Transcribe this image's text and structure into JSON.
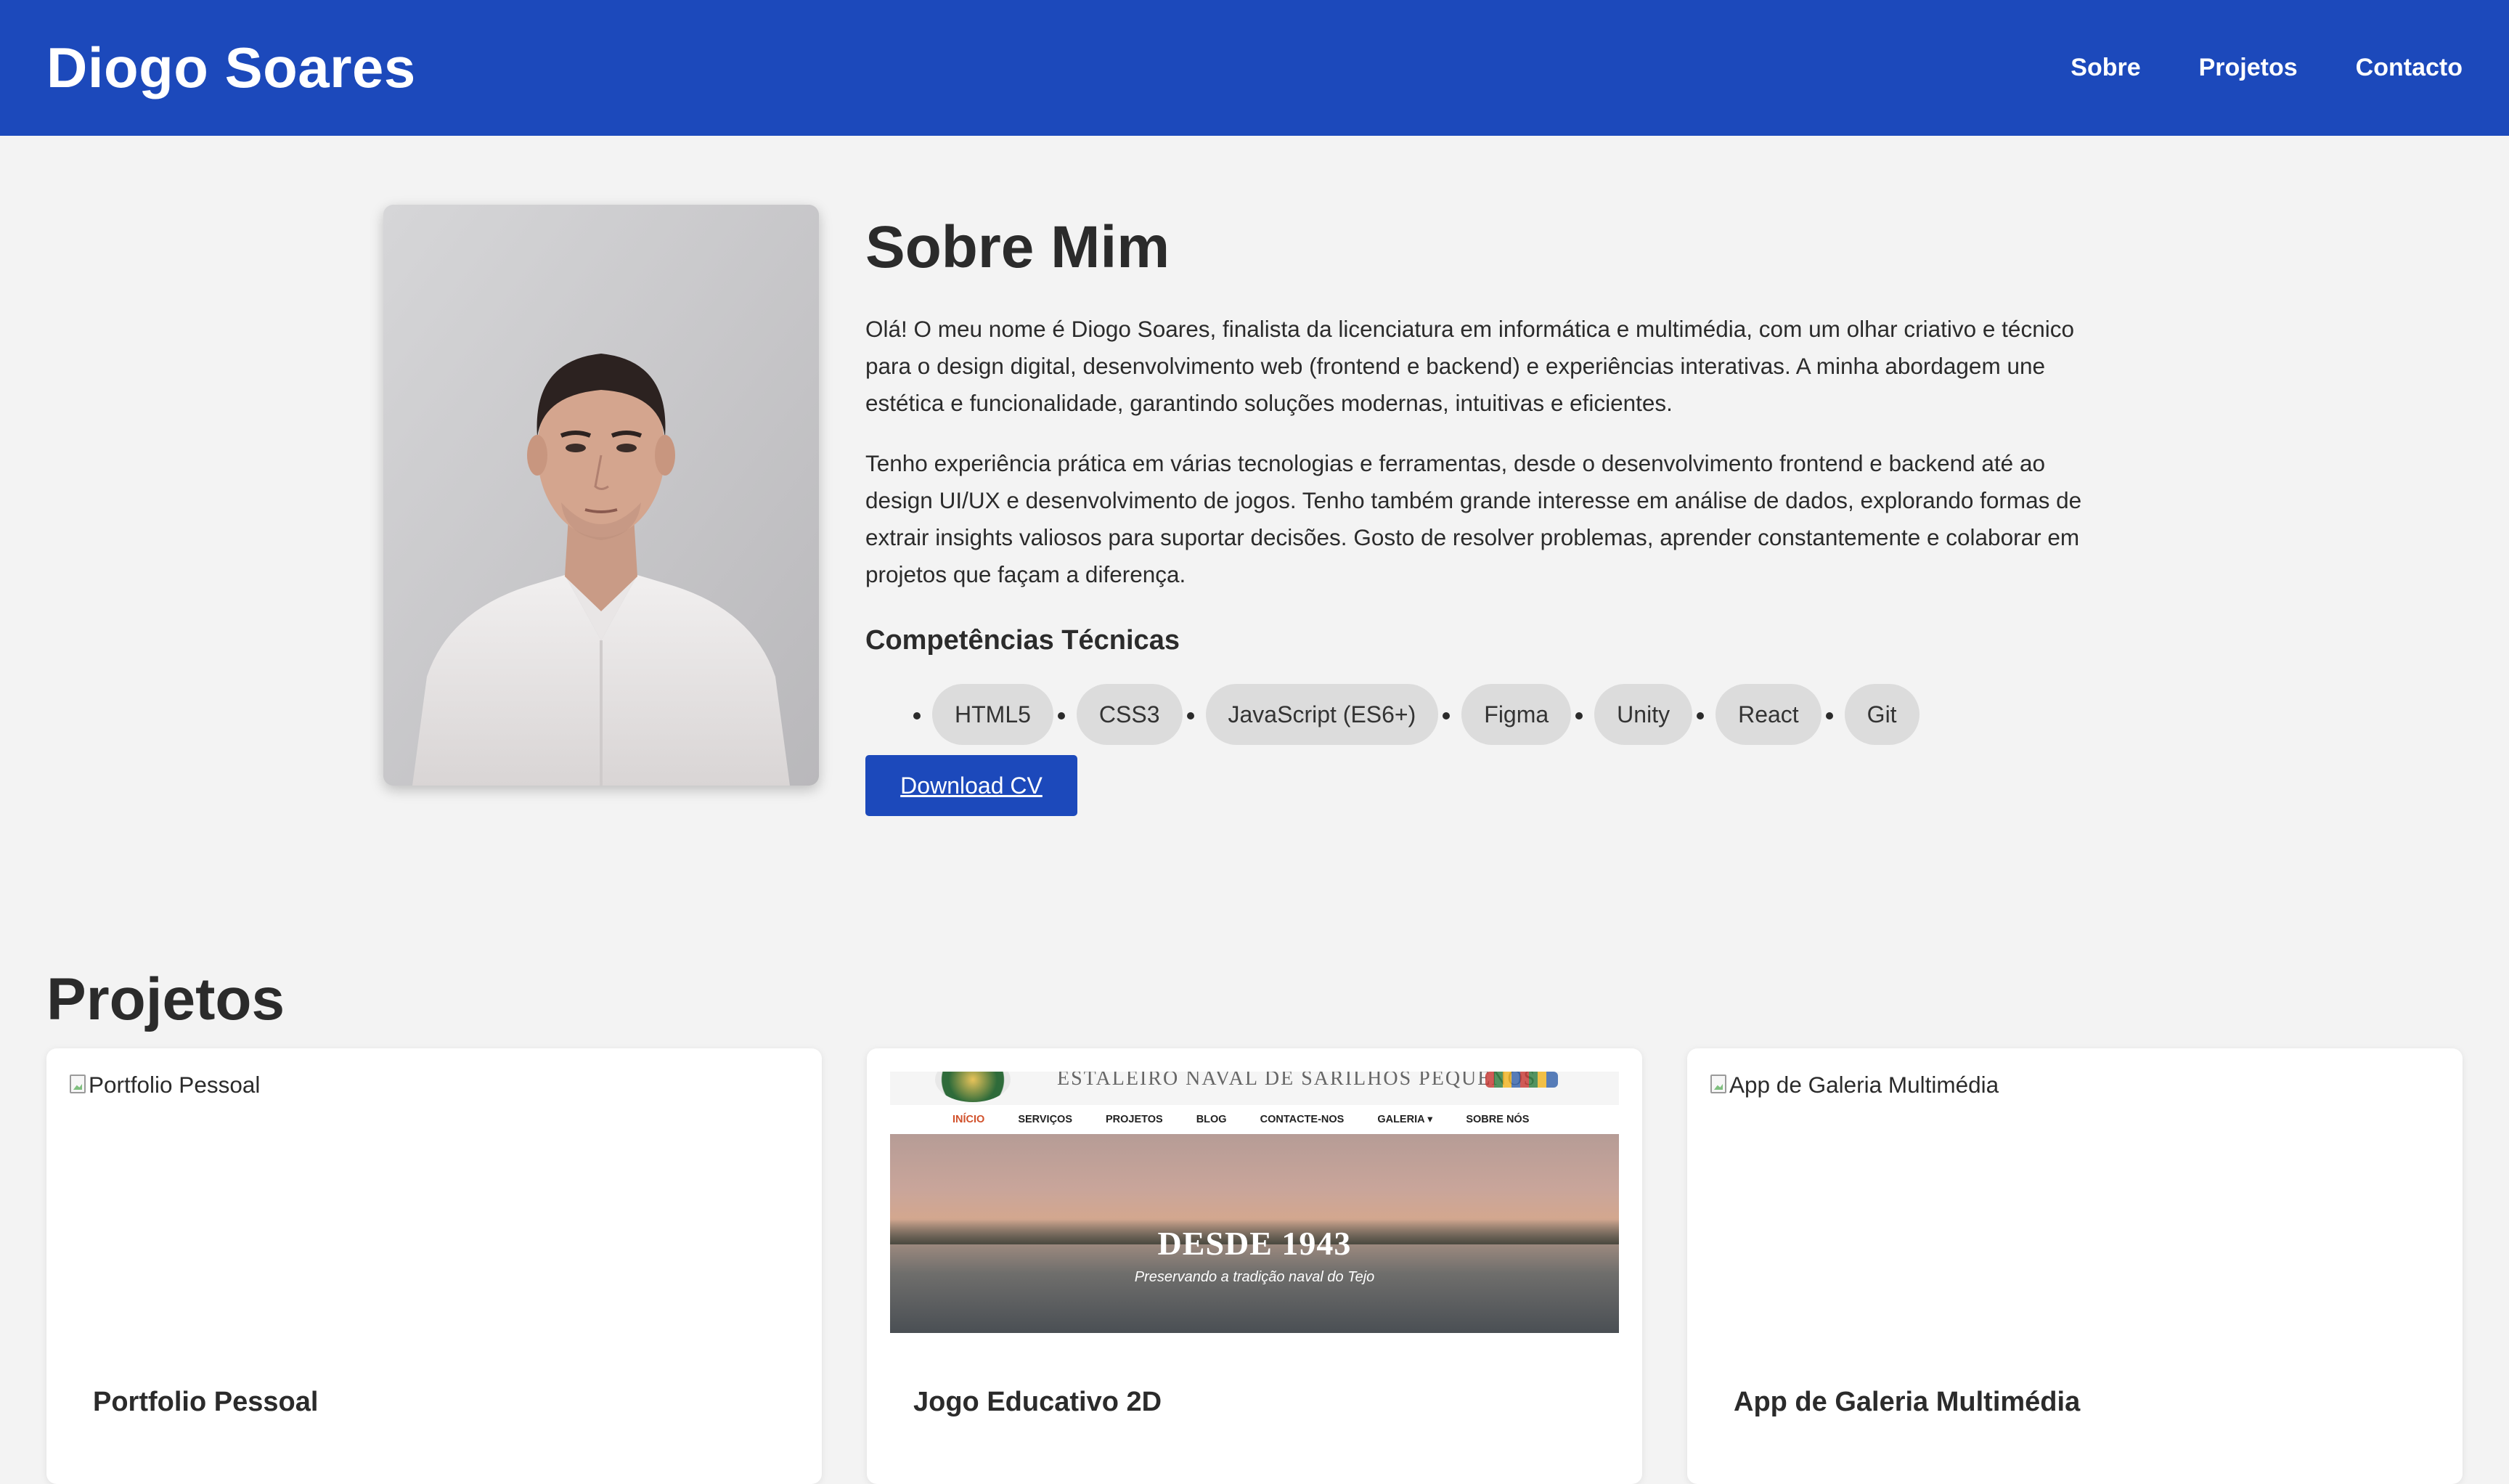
{
  "header": {
    "brand": "Diogo Soares",
    "nav": [
      "Sobre",
      "Projetos",
      "Contacto"
    ]
  },
  "about": {
    "title": "Sobre Mim",
    "photo_alt": "Diogo Soares",
    "paragraphs": [
      "Olá! O meu nome é Diogo Soares, finalista da licenciatura em informática e multimédia, com um olhar criativo e técnico para o design digital, desenvolvimento web (frontend e backend) e experiências interativas. A minha abordagem une estética e funcionalidade, garantindo soluções modernas, intuitivas e eficientes.",
      "Tenho experiência prática em várias tecnologias e ferramentas, desde o desenvolvimento frontend e backend até ao design UI/UX e desenvolvimento de jogos. Tenho também grande interesse em análise de dados, explorando formas de extrair insights valiosos para suportar decisões. Gosto de resolver problemas, aprender constantemente e colaborar em projetos que façam a diferença."
    ],
    "skills_title": "Competências Técnicas",
    "skills": [
      "HTML5",
      "CSS3",
      "JavaScript (ES6+)",
      "Figma",
      "Unity",
      "React",
      "Git"
    ],
    "cv_button": "Download CV"
  },
  "projects": {
    "title": "Projetos",
    "cards": [
      {
        "title": "Portfolio Pessoal",
        "image_alt": "Portfolio Pessoal"
      },
      {
        "title": "Jogo Educativo 2D",
        "screenshot": {
          "banner": "ESTALEIRO NAVAL DE SARILHOS PEQUENOS",
          "nav": [
            "INÍCIO",
            "SERVIÇOS",
            "PROJETOS",
            "BLOG",
            "CONTACTE-NOS",
            "GALERIA ▾",
            "SOBRE NÓS"
          ],
          "hero_title": "DESDE 1943",
          "hero_subtitle": "Preservando a tradição naval do Tejo"
        }
      },
      {
        "title": "App de Galeria Multimédia",
        "image_alt": "App de Galeria Multimédia"
      }
    ]
  },
  "colors": {
    "primary": "#1c49bb",
    "background": "#f3f3f3",
    "pill": "#dcdcdc",
    "text": "#2b2b2b"
  }
}
